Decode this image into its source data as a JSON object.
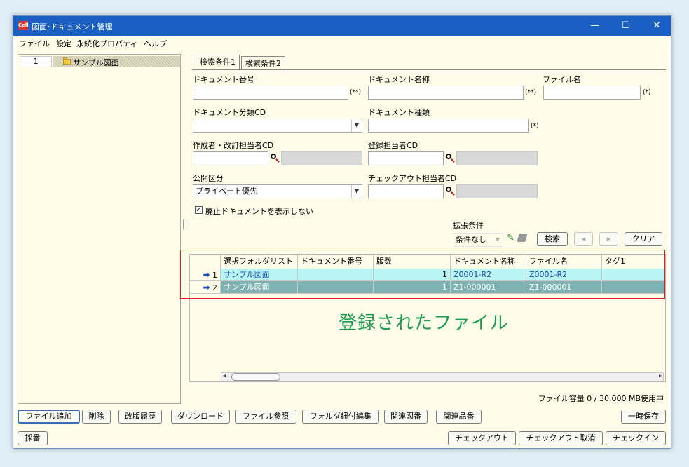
{
  "window": {
    "title": "図面･ドキュメント管理",
    "icon_text": "Cell",
    "minimize": "—",
    "maximize": "☐",
    "close": "✕"
  },
  "menu": [
    "ファイル",
    "設定",
    "永続化プロパティ",
    "ヘルプ"
  ],
  "tree": {
    "row_number": "1",
    "label": "サンプル図面"
  },
  "tabs": [
    "検索条件1",
    "検索条件2"
  ],
  "form": {
    "doc_number_label": "ドキュメント番号",
    "doc_number_mark": "(**)",
    "doc_name_label": "ドキュメント名称",
    "doc_name_mark": "(**)",
    "file_name_label": "ファイル名",
    "file_name_mark": "(*)",
    "doc_class_label": "ドキュメント分類CD",
    "doc_type_label": "ドキュメント種類",
    "doc_type_mark": "(*)",
    "author_label": "作成者・改訂担当者CD",
    "registrar_label": "登録担当者CD",
    "public_label": "公開区分",
    "public_value": "プライベート優先",
    "checkout_user_label": "チェックアウト担当者CD",
    "hide_obsolete_label": "廃止ドキュメントを表示しない",
    "hide_obsolete_check": "✓",
    "ext_label": "拡張条件",
    "ext_value": "条件なし"
  },
  "search_buttons": {
    "search": "検索",
    "prev": "◂",
    "next": "▸",
    "clear": "クリア"
  },
  "grid": {
    "columns": [
      "選択フォルダリスト",
      "ドキュメント番号",
      "版数",
      "ドキュメント名称",
      "ファイル名",
      "タグ1"
    ],
    "rows": [
      {
        "no": "1",
        "folder": "サンプル図面",
        "doc_number": "",
        "version": "1",
        "doc_name": "Z0001-R2",
        "file_name": "Z0001-R2",
        "tag1": ""
      },
      {
        "no": "2",
        "folder": "サンプル図面",
        "doc_number": "",
        "version": "1",
        "doc_name": "Z1-000001",
        "file_name": "Z1-000001",
        "tag1": ""
      }
    ]
  },
  "annotation": "登録されたファイル",
  "capacity": "ファイル容量 0 / 30,000 MB使用中",
  "bottom_buttons_row1": [
    "ファイル追加",
    "削除",
    "改版履歴",
    "ダウンロード",
    "ファイル参照",
    "フォルダ紐付編集",
    "関連図番",
    "関連品番"
  ],
  "save_temp": "一時保存",
  "numbering": "採番",
  "checkout_buttons": [
    "チェックアウト",
    "チェックアウト取消",
    "チェックイン"
  ],
  "colors": {
    "titlebar": "#1a5fc3",
    "row1": "#b9f5f2",
    "row2": "#7fb2b2",
    "annotation": "#1a9c4f",
    "highlight": "#e02020"
  }
}
